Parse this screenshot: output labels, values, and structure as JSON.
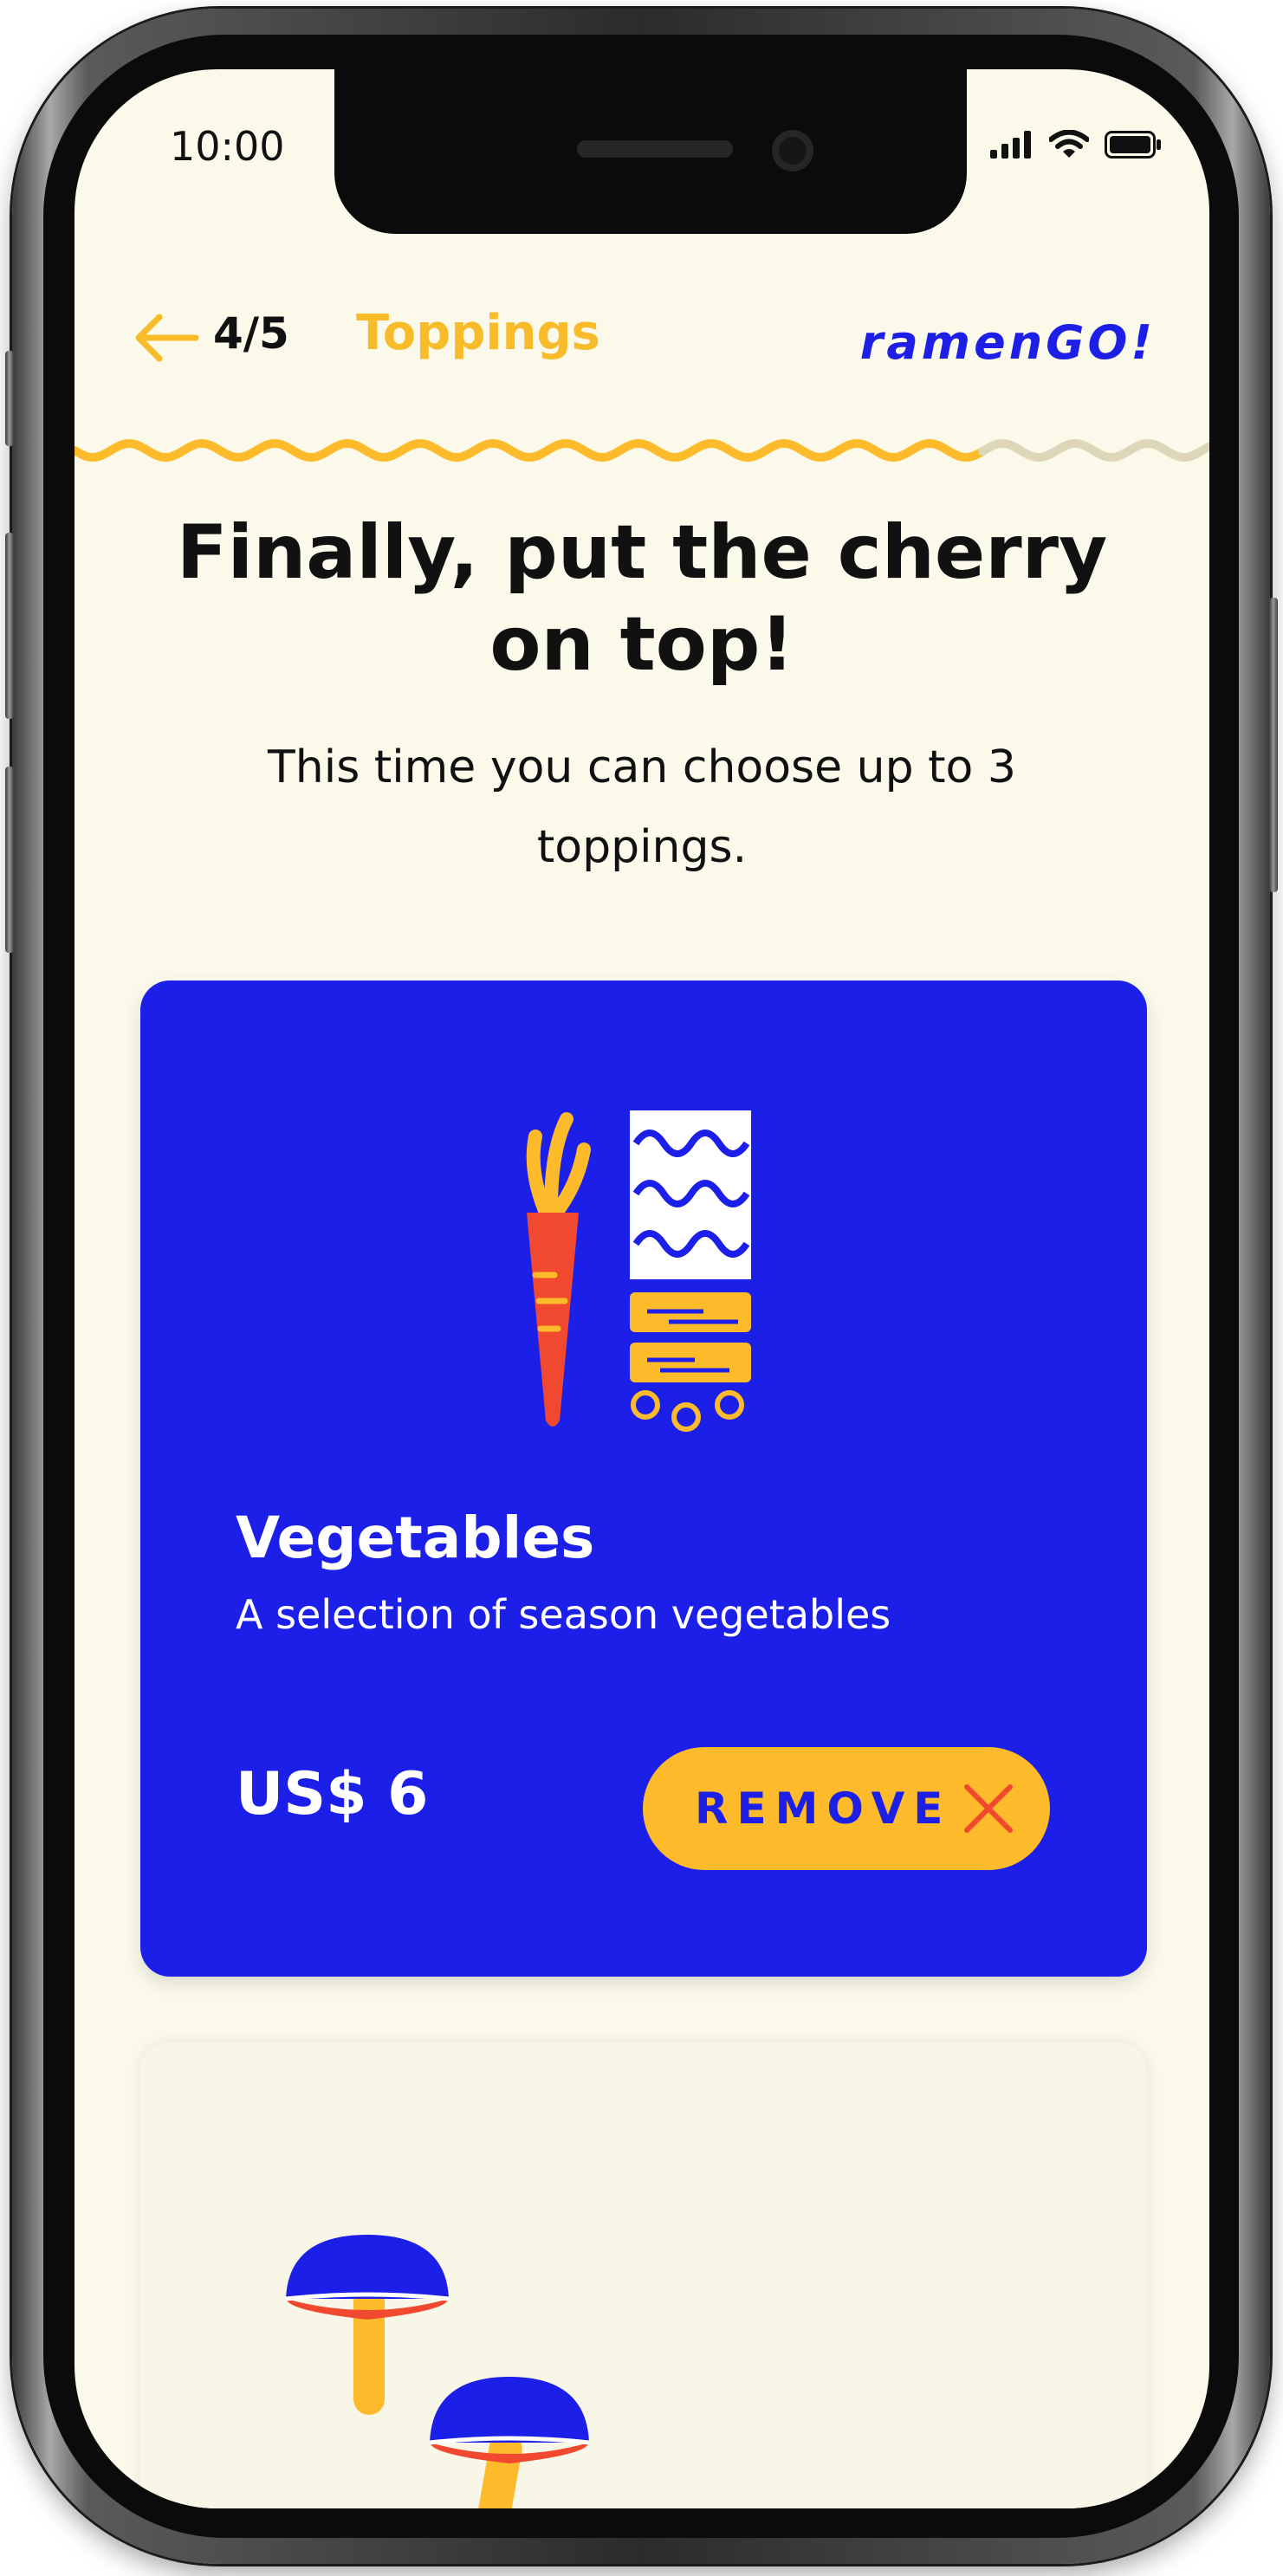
{
  "status_bar": {
    "time": "10:00",
    "icons": [
      "cellular-signal-icon",
      "wifi-icon",
      "battery-icon"
    ]
  },
  "header": {
    "back_icon": "arrow-left-icon",
    "step_count": "4/5",
    "step_title": "Toppings",
    "brand": "ramenGO!",
    "progress_steps_done": 4,
    "progress_steps_total": 5
  },
  "main": {
    "headline": "Finally, put the cherry on top!",
    "subtitle": "This time you can choose up to 3 toppings."
  },
  "toppings": [
    {
      "name": "Vegetables",
      "description": "A selection of season vegetables",
      "price": "US$ 6",
      "selected": true,
      "action_label": "REMOVE",
      "action_icon": "close-icon",
      "illustration": "vegetables-illustration"
    },
    {
      "selected": false,
      "illustration": "mushrooms-illustration"
    }
  ],
  "colors": {
    "background": "#fbf9ea",
    "accent_yellow": "#fdbb2b",
    "brand_blue": "#1b1fe8",
    "carrot_red": "#f0492f",
    "progress_remaining": "#ded6b8"
  }
}
